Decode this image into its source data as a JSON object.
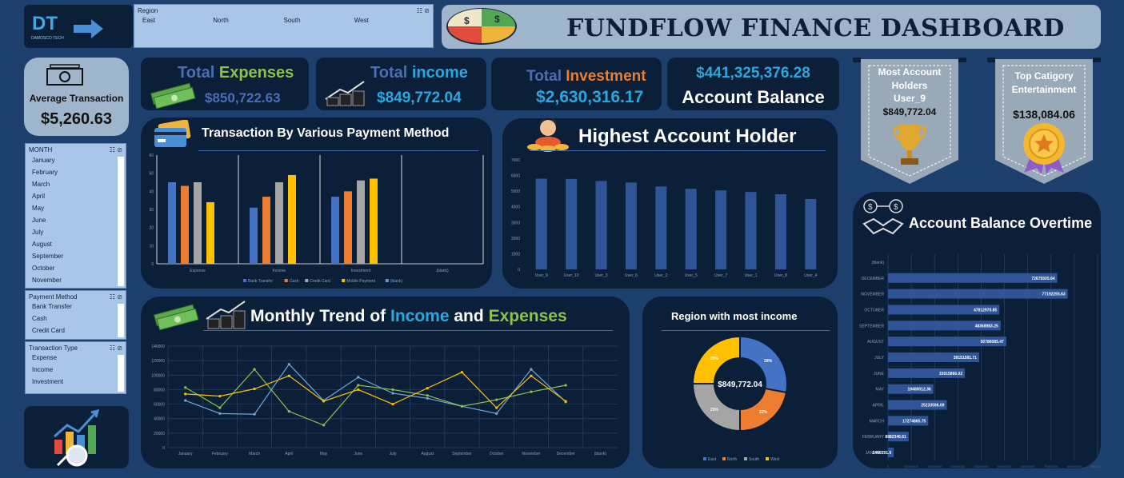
{
  "brand": {
    "logo_text": "DT",
    "logo_sub": "DAMOSCO TECH"
  },
  "region_slicer": {
    "title": "Region",
    "items": [
      "East",
      "North",
      "South",
      "West"
    ]
  },
  "header": {
    "title": "FUNDFLOW FINANCE DASHBOARD"
  },
  "avg_transaction": {
    "label": "Average Transaction",
    "value": "$5,260.63"
  },
  "kpis": {
    "expenses": {
      "w1": "Total",
      "w2": "Expenses",
      "value": "$850,722.63"
    },
    "income": {
      "w1": "Total",
      "w2": "income",
      "value": "$849,772.04"
    },
    "investment": {
      "w1": "Total",
      "w2": "Investment",
      "value": "$2,630,316.17"
    },
    "balance": {
      "value": "$441,325,376.28",
      "label": "Account Balance"
    }
  },
  "ribbons": {
    "most_holder": {
      "line1": "Most Account",
      "line2": "Holders",
      "line3": "User_9",
      "value": "$849,772.04"
    },
    "top_category": {
      "line1": "Top Catigory",
      "line2": "Entertainment",
      "value": "$138,084.06"
    }
  },
  "month_slicer": {
    "title": "MONTH",
    "items": [
      "January",
      "February",
      "March",
      "April",
      "May",
      "June",
      "July",
      "August",
      "September",
      "October",
      "November"
    ]
  },
  "payment_slicer": {
    "title": "Payment Method",
    "items": [
      "Bank Transfer",
      "Cash",
      "Credit Card"
    ]
  },
  "type_slicer": {
    "title": "Transaction Type",
    "items": [
      "Expense",
      "Income",
      "Investment"
    ]
  },
  "colors": {
    "bank": "#4472c4",
    "cash": "#ed7d31",
    "credit": "#a5a5a5",
    "mobile": "#ffc000",
    "blank": "#5b9bd5",
    "income_line": "#6fa8dc",
    "expense_line": "#8bc34a",
    "investment_line": "#ffc000"
  },
  "chart_data": [
    {
      "id": "payment",
      "type": "bar",
      "title": "Transaction By Various Payment Method",
      "categories": [
        "Expense",
        "Income",
        "Investment",
        "(blank)"
      ],
      "series": [
        {
          "name": "Bank Transfer",
          "values": [
            45,
            31,
            37,
            0
          ]
        },
        {
          "name": "Cash",
          "values": [
            43,
            37,
            40,
            0
          ]
        },
        {
          "name": "Credit Card",
          "values": [
            45,
            45,
            46,
            0
          ]
        },
        {
          "name": "Mobile Payment",
          "values": [
            34,
            49,
            47,
            0
          ]
        },
        {
          "name": "(blank)",
          "values": [
            0,
            0,
            0,
            0
          ]
        }
      ],
      "ylim": [
        0,
        60
      ],
      "yticks": [
        "0",
        "10",
        "20",
        "30",
        "40",
        "50",
        "60"
      ]
    },
    {
      "id": "holders",
      "type": "bar",
      "title": "Highest Account Holder",
      "categories": [
        "User_9",
        "User_10",
        "User_3",
        "User_6",
        "User_2",
        "User_5",
        "User_7",
        "User_1",
        "User_8",
        "User_4"
      ],
      "values": [
        5800,
        5780,
        5650,
        5550,
        5300,
        5150,
        5050,
        4950,
        4800,
        4500
      ],
      "ylim": [
        0,
        7000
      ],
      "yticks": [
        "0",
        "1000",
        "2000",
        "3000",
        "4000",
        "5000",
        "6000",
        "7000"
      ]
    },
    {
      "id": "trend",
      "type": "line",
      "title_parts": [
        "Monthly Trend of",
        "Income",
        "and",
        "Expenses"
      ],
      "categories": [
        "January",
        "February",
        "March",
        "April",
        "May",
        "June",
        "July",
        "August",
        "September",
        "October",
        "November",
        "December",
        "(blank)"
      ],
      "series": [
        {
          "values": [
            65000,
            47000,
            46000,
            115000,
            65000,
            97000,
            75000,
            68000,
            57000,
            47000,
            108000,
            63000
          ]
        },
        {
          "values": [
            83000,
            55000,
            108000,
            50000,
            31000,
            86000,
            80000,
            72000,
            57000,
            66000,
            77000,
            86000
          ]
        },
        {
          "values": [
            74000,
            71000,
            81000,
            99000,
            64000,
            80000,
            60000,
            82000,
            104000,
            55000,
            99000,
            64000
          ]
        }
      ],
      "ylim": [
        0,
        140000
      ],
      "yticks": [
        "0",
        "20000",
        "40000",
        "60000",
        "80000",
        "100000",
        "120000",
        "140000"
      ]
    },
    {
      "id": "region",
      "type": "pie",
      "title": "Region with most income",
      "center_label": "$849,772.04",
      "labels": [
        "East",
        "North",
        "South",
        "West"
      ],
      "values": [
        28,
        22,
        25,
        25
      ],
      "slice_labels": [
        "28%",
        "22%",
        "25%",
        "25%"
      ]
    },
    {
      "id": "balance",
      "type": "bar",
      "orientation": "horizontal",
      "title": "Account Balance Overtime",
      "categories": [
        "(blank)",
        "DECEMBER",
        "NOVEMBER",
        "OCTOBER",
        "SEPTEMBER",
        "AUGUST",
        "JULY",
        "JUNE",
        "MAY",
        "APRIL",
        "MARCH",
        "FEBRUARY",
        "JANUARY"
      ],
      "values": [
        0,
        72675505.64,
        77192255.63,
        47812970.85,
        48368983.25,
        50786085.47,
        39151581.71,
        33015866.02,
        19480012.36,
        25233596.09,
        17274865.75,
        8882346.61,
        2460191.9
      ],
      "value_labels": [
        "",
        "72675505.64",
        "77192255.63",
        "47812970.85",
        "48368983.25",
        "50786085.47",
        "39151581.71",
        "33015866.02",
        "19480012.36",
        "25233596.09",
        "17274865.75",
        "8882346.61",
        "2460191.9"
      ],
      "xlim": [
        0,
        90000000
      ],
      "xticks": [
        "0",
        "10000000",
        "20000000",
        "30000000",
        "40000000",
        "50000000",
        "60000000",
        "70000000",
        "80000000",
        "90000000"
      ]
    }
  ]
}
